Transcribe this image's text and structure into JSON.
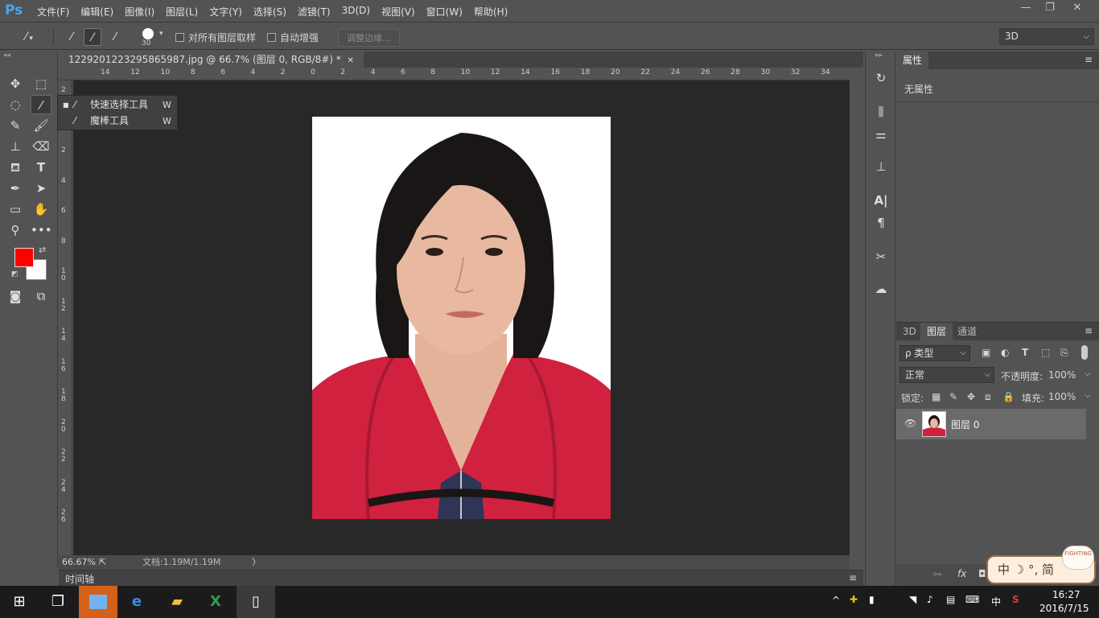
{
  "app": {
    "logo": "Ps"
  },
  "menu": [
    "文件(F)",
    "编辑(E)",
    "图像(I)",
    "图层(L)",
    "文字(Y)",
    "选择(S)",
    "滤镜(T)",
    "3D(D)",
    "视图(V)",
    "窗口(W)",
    "帮助(H)"
  ],
  "window_controls": {
    "minimize": "—",
    "restore": "❐",
    "close": "✕"
  },
  "options": {
    "brush_size": "30",
    "sample_all_layers": "对所有图层取样",
    "auto_enhance": "自动增强",
    "refine_edge": "调整边缘...",
    "workspace": "3D"
  },
  "document": {
    "tab_title": "1229201223295865987.jpg @ 66.7% (图层 0, RGB/8#) *",
    "close": "✕"
  },
  "ruler_h": [
    "14",
    "12",
    "10",
    "8",
    "6",
    "4",
    "2",
    "0",
    "2",
    "4",
    "6",
    "8",
    "10",
    "12",
    "14",
    "16",
    "18",
    "20",
    "22",
    "24",
    "26",
    "28",
    "30",
    "32",
    "34"
  ],
  "ruler_v": [
    "2",
    "0",
    "2",
    "4",
    "6",
    "8",
    "1\n0",
    "1\n2",
    "1\n4",
    "1\n6",
    "1\n8",
    "2\n0",
    "2\n2",
    "2\n4",
    "2\n6"
  ],
  "flyout": {
    "items": [
      {
        "label": "快速选择工具",
        "key": "W"
      },
      {
        "label": "魔棒工具",
        "key": "W"
      }
    ]
  },
  "status": {
    "zoom": "66.67%",
    "doc": "文档:1.19M/1.19M",
    "arrow": "〉"
  },
  "timeline": {
    "label": "时间轴"
  },
  "properties": {
    "tab": "属性",
    "empty": "无属性"
  },
  "layers_panel": {
    "tabs": [
      "3D",
      "图层",
      "通道"
    ],
    "filter": "ρ 类型",
    "blend": "正常",
    "opacity_label": "不透明度:",
    "opacity": "100%",
    "lock_label": "锁定:",
    "fill_label": "填充:",
    "fill": "100%",
    "layer_name": "图层 0"
  },
  "ime": {
    "text": "中 ☽ °, 简",
    "badge": "FIGHTING"
  },
  "taskbar": {
    "time": "16:27",
    "date": "2016/7/15",
    "lang": "中"
  },
  "colors": {
    "foreground": "#ff0000",
    "background": "#ffffff",
    "hoodie": "#d0213f",
    "hair": "#1a1615",
    "skin": "#e8b9a0"
  }
}
